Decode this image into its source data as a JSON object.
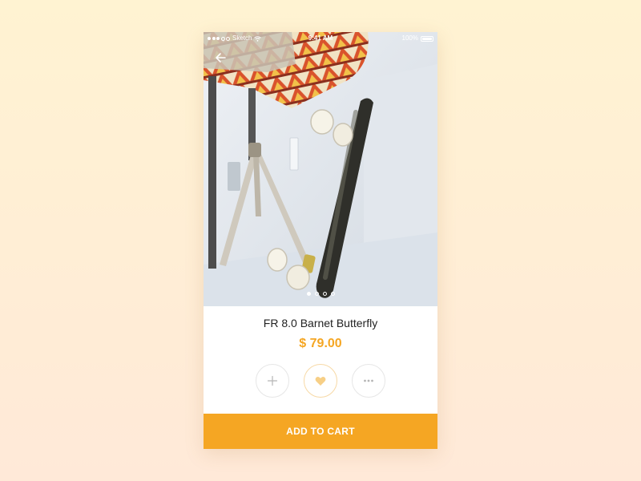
{
  "status_bar": {
    "carrier": "Sketch",
    "time": "9:41 AM",
    "battery": "100%"
  },
  "product": {
    "name": "FR 8.0 Barnet Butterfly",
    "price": "$ 79.00"
  },
  "gallery": {
    "page_count": 4,
    "active_index": 0
  },
  "actions": {
    "add_icon": "plus-icon",
    "favorite_icon": "heart-icon",
    "more_icon": "more-icon"
  },
  "cart_button": {
    "label": "ADD TO CART"
  },
  "colors": {
    "accent": "#f5a623",
    "background_top": "#fff3d2",
    "background_bottom": "#ffe9d8",
    "text": "#222222"
  }
}
